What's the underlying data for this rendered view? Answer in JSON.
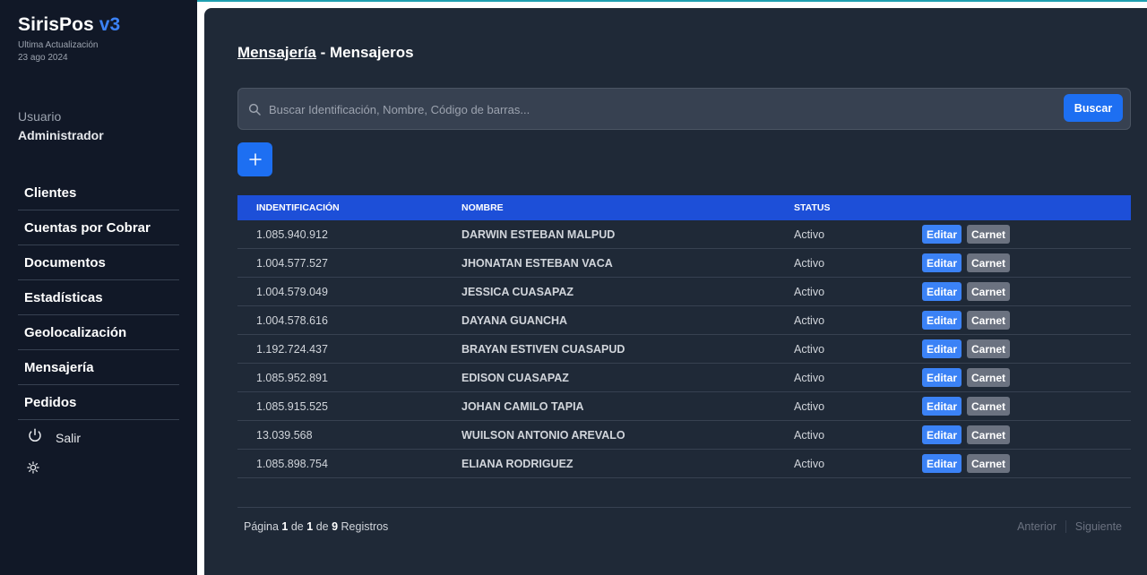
{
  "brand": {
    "name": "SirisPos",
    "version": "v3"
  },
  "update": {
    "label": "Ultima Actualización",
    "date": "23 ago 2024"
  },
  "user": {
    "label": "Usuario",
    "name": "Administrador"
  },
  "nav": [
    "Clientes",
    "Cuentas por Cobrar",
    "Documentos",
    "Estadísticas",
    "Geolocalización",
    "Mensajería",
    "Pedidos"
  ],
  "logout_label": "Salir",
  "breadcrumb": {
    "parent": "Mensajería",
    "separator": " - ",
    "current": "Mensajeros"
  },
  "search": {
    "placeholder": "Buscar Identificación, Nombre, Código de barras...",
    "value": "",
    "button": "Buscar"
  },
  "table": {
    "headers": [
      "Indentificación",
      "Nombre",
      "Status"
    ],
    "edit_label": "Editar",
    "carnet_label": "Carnet",
    "rows": [
      {
        "id": "1.085.940.912",
        "name": "DARWIN ESTEBAN MALPUD",
        "status": "Activo"
      },
      {
        "id": "1.004.577.527",
        "name": "JHONATAN ESTEBAN VACA",
        "status": "Activo"
      },
      {
        "id": "1.004.579.049",
        "name": "JESSICA CUASAPAZ",
        "status": "Activo"
      },
      {
        "id": "1.004.578.616",
        "name": "DAYANA GUANCHA",
        "status": "Activo"
      },
      {
        "id": "1.192.724.437",
        "name": "BRAYAN ESTIVEN CUASAPUD",
        "status": "Activo"
      },
      {
        "id": "1.085.952.891",
        "name": "EDISON CUASAPAZ",
        "status": "Activo"
      },
      {
        "id": "1.085.915.525",
        "name": "JOHAN CAMILO TAPIA",
        "status": "Activo"
      },
      {
        "id": "13.039.568",
        "name": "WUILSON ANTONIO AREVALO",
        "status": "Activo"
      },
      {
        "id": "1.085.898.754",
        "name": "ELIANA RODRIGUEZ",
        "status": "Activo"
      }
    ]
  },
  "pagination": {
    "page_word": "Página",
    "page": "1",
    "of_word": "de",
    "total_pages": "1",
    "of_word2": "de",
    "records": "9",
    "records_word": "Registros",
    "prev": "Anterior",
    "next": "Siguiente"
  },
  "colors": {
    "accent": "#1d6ff2",
    "header": "#1d4fd8",
    "sidebar": "#111827",
    "main": "#1f2937"
  }
}
